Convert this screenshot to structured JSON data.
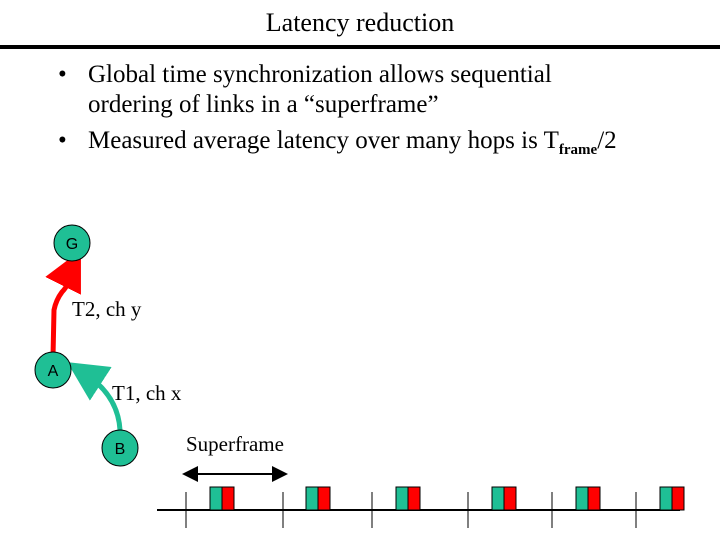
{
  "title": "Latency reduction",
  "bullets": [
    {
      "text": "Global time synchronization allows sequential",
      "text2": "ordering of links in a “superframe”"
    },
    {
      "text": "Measured average latency over many hops is T",
      "sub": "frame",
      "tail": "/2"
    }
  ],
  "diagram": {
    "nodes": [
      {
        "id": "G",
        "label": "G"
      },
      {
        "id": "A",
        "label": "A"
      },
      {
        "id": "B",
        "label": "B"
      }
    ],
    "edges": [
      {
        "from": "A",
        "to": "G",
        "label": "T2, ch y",
        "color": "#ff0000"
      },
      {
        "from": "B",
        "to": "A",
        "label": "T1, ch x",
        "color": "#1fbf95"
      }
    ],
    "node_color": "#1fbf95",
    "superframe_label": "Superframe",
    "slot_colors": {
      "t1": "#1fbf95",
      "t2": "#ff0000"
    },
    "superframe_count": 6
  }
}
